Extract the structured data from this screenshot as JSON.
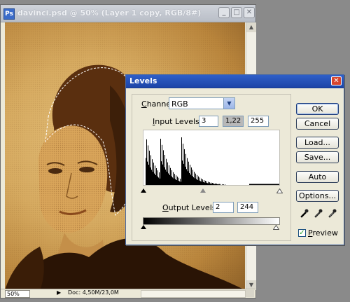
{
  "document": {
    "title": "davinci.psd @ 50% (Layer 1 copy, RGB/8#)",
    "title_icon_letter": "Ps",
    "window_buttons": {
      "minimize": "_",
      "maximize": "□",
      "close": "✕"
    },
    "zoom": "50%",
    "status_arrow": "▶",
    "doc_size": "Doc: 4,50M/23,0M",
    "scroll_up": "▲",
    "scroll_down": "▼"
  },
  "levels": {
    "title": "Levels",
    "close": "✕",
    "channel_label_accel": "C",
    "channel_label_rest": "hannel:",
    "channel_value": "RGB",
    "channel_arrow": "▼",
    "input_label_accel": "I",
    "input_label_rest": "nput Levels:",
    "input_black": "3",
    "input_gamma": "1,22",
    "input_white": "255",
    "output_label_accel": "O",
    "output_label_rest": "utput Levels:",
    "output_black": "2",
    "output_white": "244",
    "buttons": {
      "ok": "OK",
      "cancel": "Cancel",
      "load": "Load...",
      "save": "Save...",
      "auto": "Auto",
      "options": "Options..."
    },
    "preview_check": "✓",
    "preview_accel": "P",
    "preview_rest": "review",
    "preview_checked": true
  }
}
